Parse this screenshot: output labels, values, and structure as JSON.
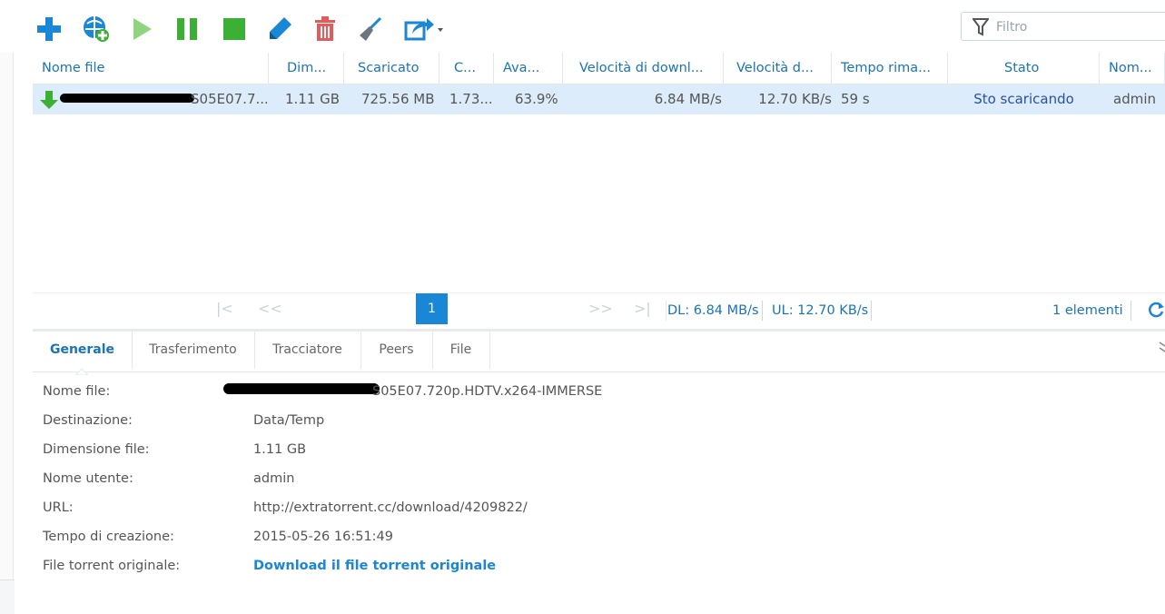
{
  "toolbar": {
    "buttons": [
      "add-icon",
      "add-url-icon",
      "resume-icon",
      "pause-icon",
      "stop-icon",
      "edit-icon",
      "delete-icon",
      "clean-icon",
      "share-icon"
    ],
    "filter_placeholder": "Filtro",
    "colors": {
      "blue": "#1a86d6",
      "green": "#3cb034",
      "red": "#e45b5b",
      "gray": "#6a7580"
    }
  },
  "grid": {
    "columns": [
      "Nome file",
      "Dim...",
      "Scaricato",
      "C...",
      "Ava...",
      "Velocità di downl...",
      "Velocità d...",
      "Tempo rima...",
      "Stato",
      "Nom..."
    ],
    "rows": [
      {
        "name": "S05E07.7...",
        "size": "1.11 GB",
        "downloaded": "725.56 MB",
        "c": "1.73...",
        "progress": "63.9%",
        "down_speed": "6.84 MB/s",
        "up_speed": "12.70 KB/s",
        "time_left": "59 s",
        "status": "Sto scaricando",
        "user": "admin"
      }
    ]
  },
  "pager": {
    "first": "|<",
    "prev": "<<",
    "page": "1",
    "next": ">>",
    "last": ">|",
    "dl": "DL: 6.84 MB/s",
    "ul": "UL: 12.70 KB/s",
    "count": "1 elementi"
  },
  "tabs": [
    "Generale",
    "Trasferimento",
    "Tracciatore",
    "Peers",
    "File"
  ],
  "details": {
    "labels": [
      "Nome file:",
      "Destinazione:",
      "Dimensione file:",
      "Nome utente:",
      "URL:",
      "Tempo di creazione:",
      "File torrent originale:"
    ],
    "filename": "S05E07.720p.HDTV.x264-IMMERSE",
    "destination": "Data/Temp",
    "size": "1.11 GB",
    "user": "admin",
    "url": "http://extratorrent.cc/download/4209822/",
    "created": "2015-05-26 16:51:49",
    "torrent_link": "Download il file torrent originale"
  }
}
